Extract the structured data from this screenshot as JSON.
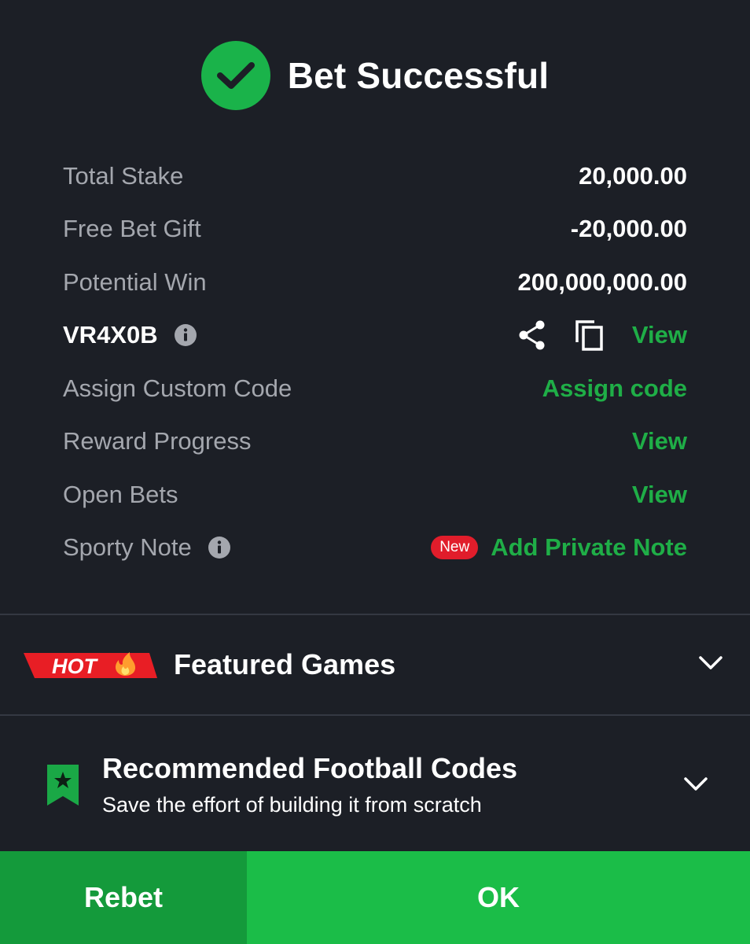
{
  "header": {
    "title": "Bet Successful",
    "icon": "check-circle-icon"
  },
  "summary": {
    "total_stake_label": "Total Stake",
    "total_stake_value": "20,000.00",
    "free_bet_label": "Free Bet Gift",
    "free_bet_value": "-20,000.00",
    "potential_win_label": "Potential Win",
    "potential_win_value": "200,000,000.00",
    "booking_code": "VR4X0B",
    "booking_view_label": "View",
    "custom_code_label": "Assign Custom Code",
    "custom_code_action": "Assign code",
    "reward_label": "Reward Progress",
    "reward_action": "View",
    "open_bets_label": "Open Bets",
    "open_bets_action": "View",
    "note_label": "Sporty Note",
    "note_badge": "New",
    "note_action": "Add Private Note"
  },
  "featured": {
    "badge": "HOT",
    "title": "Featured Games"
  },
  "recommended": {
    "title": "Recommended Football Codes",
    "subtitle": "Save the effort of building it from scratch"
  },
  "footer": {
    "rebet_label": "Rebet",
    "ok_label": "OK"
  },
  "colors": {
    "background": "#1c1f26",
    "accent_green": "#1fae47",
    "ok_button": "#1bbd48",
    "rebet_button": "#149a3b",
    "badge_red": "#e11d2b"
  }
}
